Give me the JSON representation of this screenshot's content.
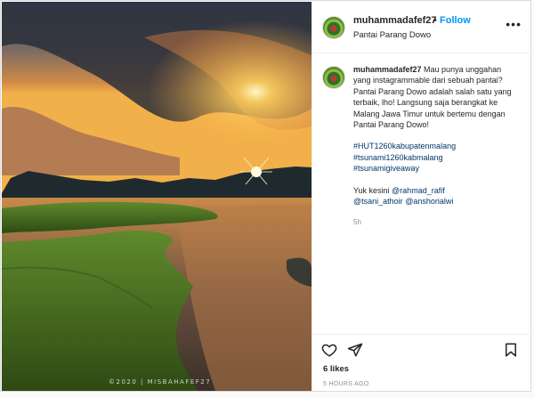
{
  "post": {
    "username": "muhammadafef27",
    "follow_label": "Follow",
    "separator": "•",
    "location": "Pantai Parang Dowo",
    "more_label": "•••",
    "watermark": "©2020 | MISBAHAFEF27"
  },
  "caption": {
    "username": "muhammadafef27",
    "body": "Mau punya unggahan yang instagrammable dari sebuah pantai? Pantai Parang Dowo adalah salah satu yang terbaik, lho! Langsung saja berangkat ke Malang Jawa Timur untuk bertemu dengan Pantai Parang Dowo!",
    "hashtags": [
      "#HUT1260kabupatenmalang",
      "#tsunami1260kabmalang",
      "#tsunamigiveaway"
    ],
    "mentions_intro": "Yuk kesini",
    "mentions": [
      "@rahmad_rafif",
      "@tsani_athoir",
      "@anshorialwi"
    ],
    "time": "5h"
  },
  "footer": {
    "likes": "6 likes",
    "timestamp": "5 HOURS AGO"
  },
  "icons": {
    "like": "heart-icon",
    "share": "paper-plane-icon",
    "save": "bookmark-icon",
    "more": "more-horizontal-icon"
  }
}
